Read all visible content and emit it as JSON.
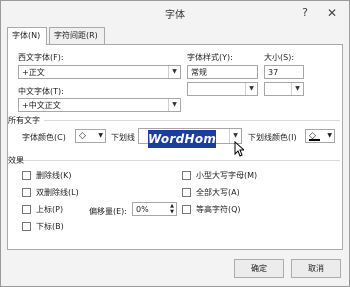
{
  "window": {
    "title": "字体",
    "help_glyph": "?",
    "close_glyph": "✕"
  },
  "tabs": [
    {
      "label": "字体(N)",
      "active": true
    },
    {
      "label": "字符间距(R)",
      "active": false
    }
  ],
  "font": {
    "western_label": "西文字体(F):",
    "western_value": "+正文",
    "style_label": "字体样式(Y):",
    "style_value": "常规",
    "size_label": "大小(S):",
    "size_value": "37",
    "chinese_label": "中文字体(T):",
    "chinese_value": "+中文正文"
  },
  "all_text": {
    "section_label": "所有文字",
    "font_color_label": "字体颜色(C)",
    "underline_label": "下划线",
    "underline_preview": "WordHome",
    "underline_color_label": "下划线颜色(I)",
    "font_color_icon": "paint-bucket-icon",
    "underline_color_icon": "paint-bucket-icon"
  },
  "effects": {
    "section_label": "效果",
    "left": [
      {
        "label": "删除线(K)",
        "checked": false
      },
      {
        "label": "双删除线(L)",
        "checked": false
      },
      {
        "label": "上标(P)",
        "checked": false
      },
      {
        "label": "下标(B)",
        "checked": false
      }
    ],
    "offset_label": "偏移量(E):",
    "offset_value": "0%",
    "right": [
      {
        "label": "小型大写字母(M)",
        "checked": false
      },
      {
        "label": "全部大写(A)",
        "checked": false
      },
      {
        "label": "等高字符(Q)",
        "checked": false
      }
    ]
  },
  "buttons": {
    "ok": "确定",
    "cancel": "取消"
  },
  "colors": {
    "preview_bg": "#1b3e9c",
    "font_color_bar": "#000000"
  }
}
